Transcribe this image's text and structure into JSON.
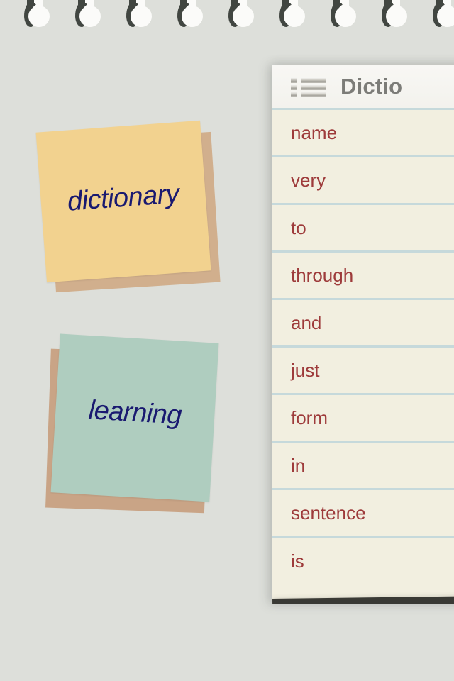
{
  "app": {
    "background_color": "#dddfda"
  },
  "binding": {
    "icon": "spiral-ring-icon",
    "ring_count": 9,
    "ring_color": "#fbfbf9",
    "ring_shadow_color": "#414641"
  },
  "notes": [
    {
      "id": "dictionary",
      "label": "dictionary",
      "paper_color": "#f2d28f",
      "text_color": "#191970"
    },
    {
      "id": "learning",
      "label": "learning",
      "paper_color": "#afcdbf",
      "text_color": "#191970"
    }
  ],
  "panel": {
    "header": {
      "menu_icon": "list-icon",
      "title": "Dictio",
      "title_color": "#7c7c78",
      "background_color": "#f5f4f0"
    },
    "list": {
      "background_color": "#f2efe0",
      "separator_color": "#c6d9db",
      "text_color": "#9e3b3b",
      "items": [
        {
          "word": "name"
        },
        {
          "word": "very"
        },
        {
          "word": "to"
        },
        {
          "word": "through"
        },
        {
          "word": "and"
        },
        {
          "word": "just"
        },
        {
          "word": "form"
        },
        {
          "word": "in"
        },
        {
          "word": "sentence"
        },
        {
          "word": "is"
        }
      ]
    },
    "bottom_bar_color": "#3a3a35"
  }
}
